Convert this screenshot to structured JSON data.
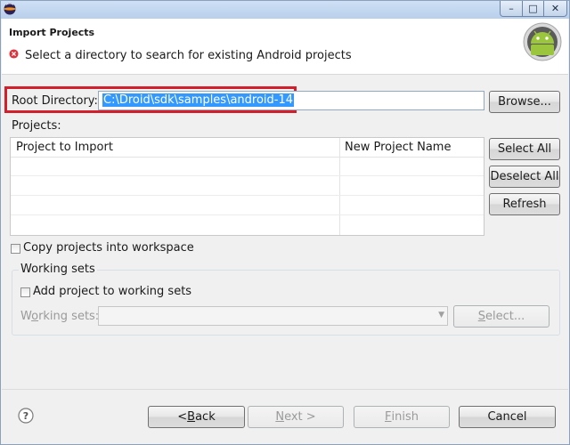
{
  "window": {
    "app_icon": "eclipse-icon",
    "minimize_glyph": "–",
    "maximize_glyph": "□",
    "close_glyph": "✕"
  },
  "header": {
    "title": "Import Projects",
    "message": "Select a directory to search for existing Android projects",
    "status_icon": "error-icon",
    "logo": "android-logo"
  },
  "root": {
    "label": "Root Directory:",
    "value": "C:\\Droid\\sdk\\samples\\android-14",
    "browse_label": "Browse..."
  },
  "projects": {
    "label": "Projects:",
    "columns": [
      "Project to Import",
      "New Project Name"
    ],
    "rows": [],
    "select_all_label": "Select All",
    "deselect_all_label": "Deselect All",
    "refresh_label": "Refresh"
  },
  "copy_projects": {
    "label": "Copy projects into workspace",
    "checked": false
  },
  "working_sets": {
    "group_label": "Working sets",
    "add_label": "Add project to working sets",
    "add_checked": false,
    "sets_label_pre": "W",
    "sets_label_ul": "o",
    "sets_label_post": "rking sets:",
    "sets_value": "",
    "select_label_pre": "",
    "select_label_ul": "S",
    "select_label_post": "elect..."
  },
  "footer": {
    "help_icon": "help-icon",
    "back_pre": "< ",
    "back_ul": "B",
    "back_post": "ack",
    "next_pre": "",
    "next_ul": "N",
    "next_post": "ext >",
    "finish_pre": "",
    "finish_ul": "F",
    "finish_post": "inish",
    "cancel_label": "Cancel"
  },
  "colors": {
    "highlight_border": "#d21f2b",
    "selection": "#3399ff",
    "android_green": "#9bc53d"
  }
}
